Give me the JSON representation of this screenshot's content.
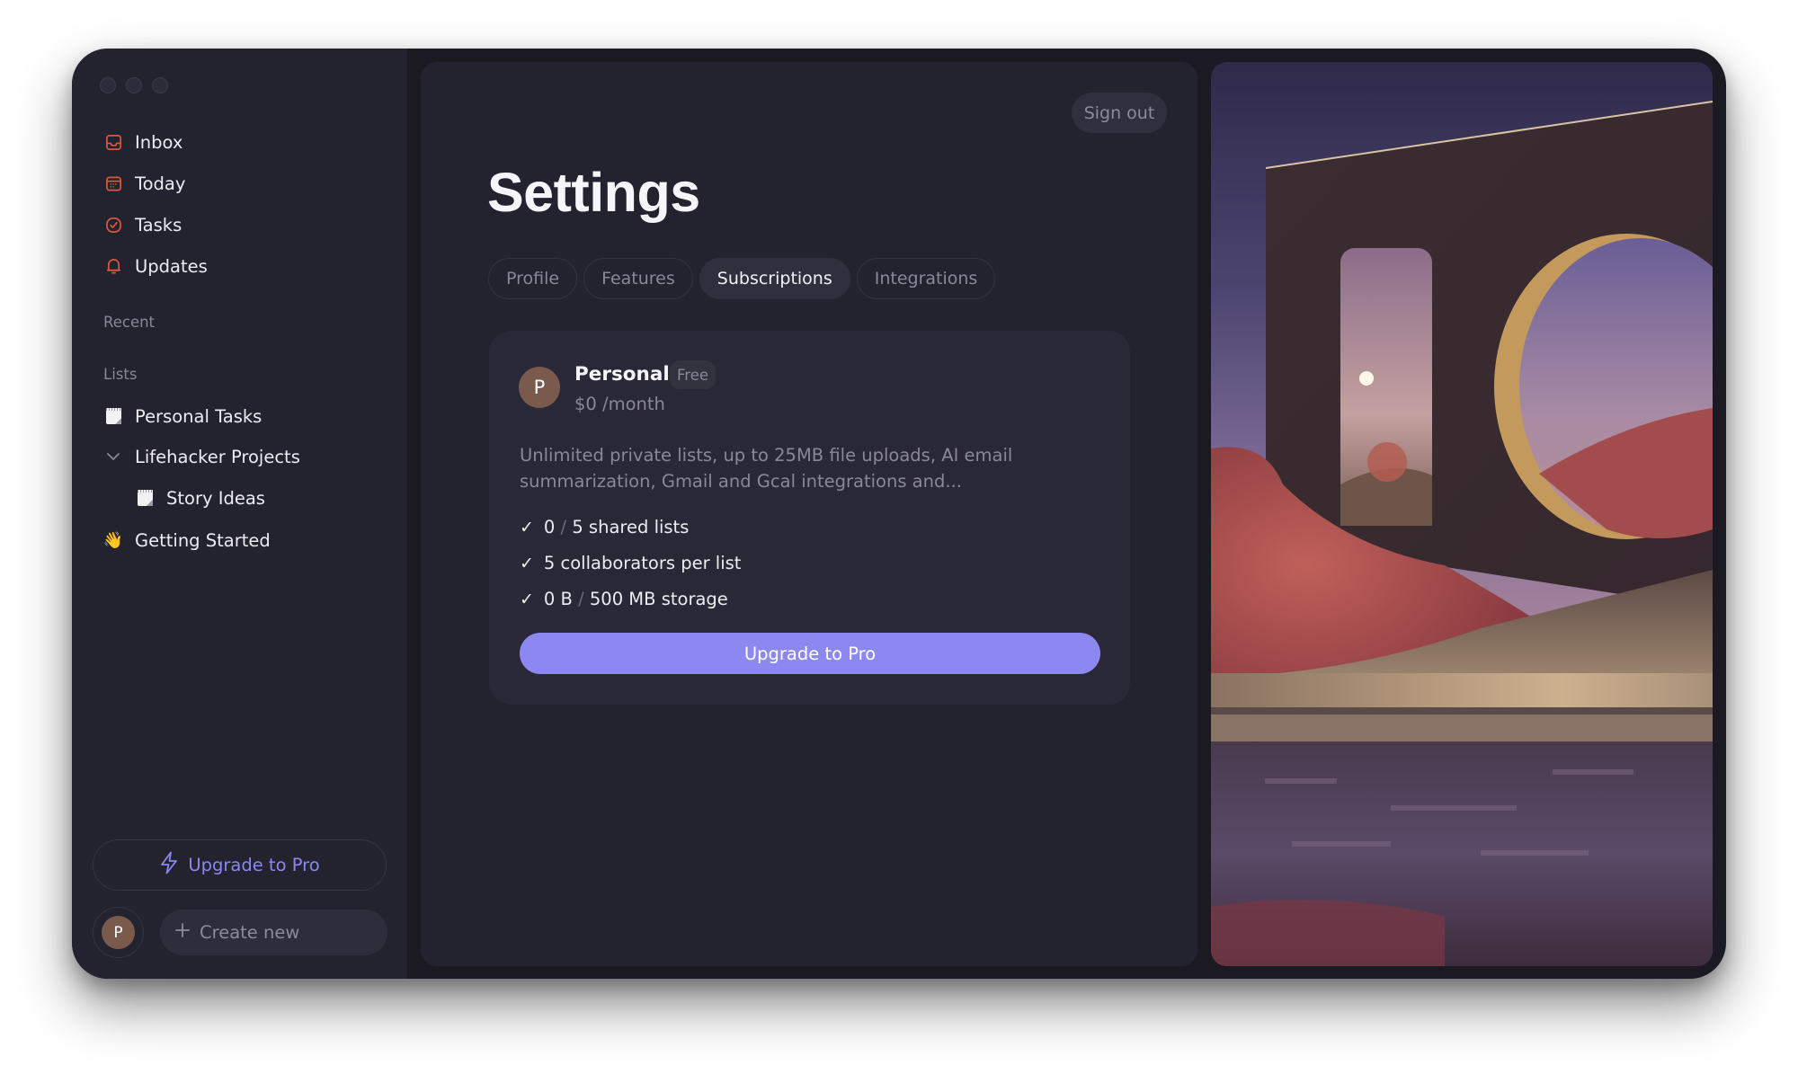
{
  "window": {
    "traffic_lights": [
      "close",
      "minimize",
      "zoom"
    ]
  },
  "sidebar": {
    "nav": [
      {
        "label": "Inbox",
        "icon": "inbox-icon"
      },
      {
        "label": "Today",
        "icon": "calendar-icon"
      },
      {
        "label": "Tasks",
        "icon": "check-circle-icon"
      },
      {
        "label": "Updates",
        "icon": "bell-icon"
      }
    ],
    "recent_label": "Recent",
    "lists_label": "Lists",
    "lists": [
      {
        "label": "Personal Tasks",
        "icon": "notepad-icon",
        "level": 0
      },
      {
        "label": "Lifehacker Projects",
        "icon": "chevron-down-icon",
        "level": 0,
        "expanded": true
      },
      {
        "label": "Story Ideas",
        "icon": "notepad-icon",
        "level": 1
      },
      {
        "label": "Getting Started",
        "icon": "waving-hand-icon",
        "glyph": "👋",
        "level": 0
      }
    ],
    "upgrade_label": "Upgrade to Pro",
    "avatar_initial": "P",
    "create_new_label": "Create new"
  },
  "main": {
    "sign_out_label": "Sign out",
    "title": "Settings",
    "tabs": [
      {
        "label": "Profile",
        "active": false
      },
      {
        "label": "Features",
        "active": false
      },
      {
        "label": "Subscriptions",
        "active": true
      },
      {
        "label": "Integrations",
        "active": false
      }
    ],
    "plan": {
      "avatar_initial": "P",
      "name": "Personal",
      "badge": "Free",
      "price": "$0 /month",
      "description": "Unlimited private lists, up to 25MB file uploads, AI email summarization, Gmail and Gcal integrations and...",
      "features": [
        {
          "used": "0",
          "sep": "/",
          "rest": "5 shared lists"
        },
        {
          "used": "",
          "sep": "",
          "rest": "5 collaborators per list"
        },
        {
          "used": "0 B",
          "sep": "/",
          "rest": "500 MB storage"
        }
      ],
      "upgrade_label": "Upgrade to Pro"
    }
  },
  "colors": {
    "accent": "#8d88f1",
    "icon_accent": "#d9593f",
    "sidebar_bg": "#23222f",
    "window_bg": "#1b1a23"
  }
}
